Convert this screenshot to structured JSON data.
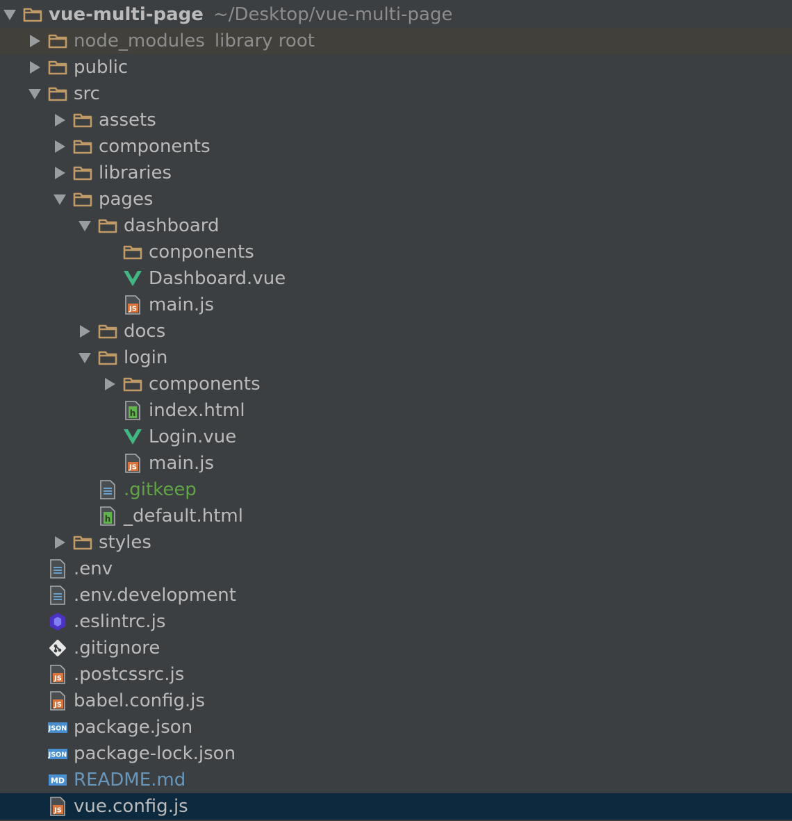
{
  "project_tree": {
    "items": [
      {
        "name": "vue-multi-page",
        "extra": "~/Desktop/vue-multi-page",
        "depth": 0,
        "type": "folder",
        "expanded": true,
        "style": "bold"
      },
      {
        "name": "node_modules",
        "extra": "library root",
        "depth": 1,
        "type": "folder",
        "expanded": false,
        "style": "muted",
        "highlight": "library"
      },
      {
        "name": "public",
        "depth": 1,
        "type": "folder",
        "expanded": false
      },
      {
        "name": "src",
        "depth": 1,
        "type": "folder",
        "expanded": true
      },
      {
        "name": "assets",
        "depth": 2,
        "type": "folder",
        "expanded": false
      },
      {
        "name": "components",
        "depth": 2,
        "type": "folder",
        "expanded": false
      },
      {
        "name": "libraries",
        "depth": 2,
        "type": "folder",
        "expanded": false
      },
      {
        "name": "pages",
        "depth": 2,
        "type": "folder",
        "expanded": true
      },
      {
        "name": "dashboard",
        "depth": 3,
        "type": "folder",
        "expanded": true
      },
      {
        "name": "conponents",
        "depth": 4,
        "type": "folder",
        "expanded": null
      },
      {
        "name": "Dashboard.vue",
        "depth": 4,
        "type": "vue"
      },
      {
        "name": "main.js",
        "depth": 4,
        "type": "js"
      },
      {
        "name": "docs",
        "depth": 3,
        "type": "folder",
        "expanded": false
      },
      {
        "name": "login",
        "depth": 3,
        "type": "folder",
        "expanded": true
      },
      {
        "name": "components",
        "depth": 4,
        "type": "folder",
        "expanded": false
      },
      {
        "name": "index.html",
        "depth": 4,
        "type": "html"
      },
      {
        "name": "Login.vue",
        "depth": 4,
        "type": "vue"
      },
      {
        "name": "main.js",
        "depth": 4,
        "type": "js"
      },
      {
        "name": ".gitkeep",
        "depth": 3,
        "type": "text",
        "style": "green"
      },
      {
        "name": "_default.html",
        "depth": 3,
        "type": "html"
      },
      {
        "name": "styles",
        "depth": 2,
        "type": "folder",
        "expanded": false
      },
      {
        "name": ".env",
        "depth": 1,
        "type": "text"
      },
      {
        "name": ".env.development",
        "depth": 1,
        "type": "text"
      },
      {
        "name": ".eslintrc.js",
        "depth": 1,
        "type": "eslint"
      },
      {
        "name": ".gitignore",
        "depth": 1,
        "type": "git"
      },
      {
        "name": ".postcssrc.js",
        "depth": 1,
        "type": "js"
      },
      {
        "name": "babel.config.js",
        "depth": 1,
        "type": "js"
      },
      {
        "name": "package.json",
        "depth": 1,
        "type": "json"
      },
      {
        "name": "package-lock.json",
        "depth": 1,
        "type": "json"
      },
      {
        "name": "README.md",
        "depth": 1,
        "type": "md",
        "style": "blue"
      },
      {
        "name": "vue.config.js",
        "depth": 1,
        "type": "js",
        "highlight": "selected"
      }
    ]
  },
  "icons": {
    "folder": "folder-icon",
    "vue": "vue-file-icon",
    "js": "js-file-icon",
    "html": "html-file-icon",
    "text": "text-file-icon",
    "eslint": "eslint-config-icon",
    "git": "git-file-icon",
    "json": "json-file-icon",
    "md": "markdown-file-icon"
  },
  "colors": {
    "background": "#3c3f41",
    "text": "#bbbbbb",
    "muted": "#8d8d8d",
    "folder": "#c19b67",
    "vue": "#41b883",
    "js_badge": "#d8743d",
    "html_badge": "#5fb44e",
    "eslint": "#4b32c3",
    "json_badge": "#4a8fcf",
    "md_badge": "#4a8fcf",
    "git_added": "#62a34a",
    "modified": "#6897bb",
    "library_row": "#41403a",
    "selected_row": "#0d293e"
  }
}
